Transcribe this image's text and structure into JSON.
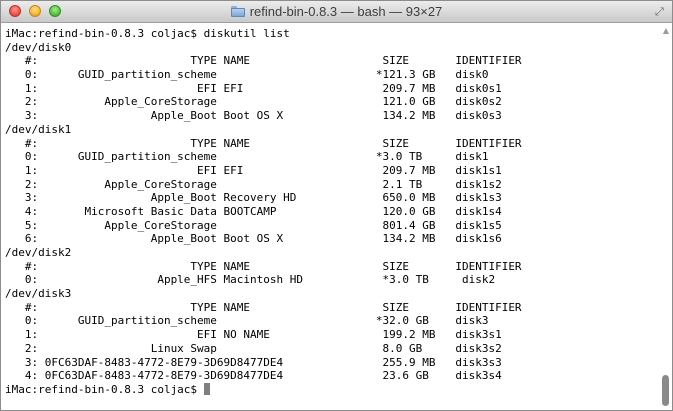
{
  "window": {
    "title": "refind-bin-0.8.3 — bash — 93×27",
    "icons": {
      "title_folder": "folder-icon",
      "fullscreen": "fullscreen-icon",
      "scroll_up": "chevron-up-icon"
    }
  },
  "terminal": {
    "lines": [
      "iMac:refind-bin-0.8.3 coljac$ diskutil list",
      "/dev/disk0",
      "   #:                       TYPE NAME                    SIZE       IDENTIFIER",
      "   0:      GUID_partition_scheme                        *121.3 GB   disk0",
      "   1:                        EFI EFI                     209.7 MB   disk0s1",
      "   2:          Apple_CoreStorage                         121.0 GB   disk0s2",
      "   3:                 Apple_Boot Boot OS X               134.2 MB   disk0s3",
      "/dev/disk1",
      "   #:                       TYPE NAME                    SIZE       IDENTIFIER",
      "   0:      GUID_partition_scheme                        *3.0 TB     disk1",
      "   1:                        EFI EFI                     209.7 MB   disk1s1",
      "   2:          Apple_CoreStorage                         2.1 TB     disk1s2",
      "   3:                 Apple_Boot Recovery HD             650.0 MB   disk1s3",
      "   4:       Microsoft Basic Data BOOTCAMP                120.0 GB   disk1s4",
      "   5:          Apple_CoreStorage                         801.4 GB   disk1s5",
      "   6:                 Apple_Boot Boot OS X               134.2 MB   disk1s6",
      "/dev/disk2",
      "   #:                       TYPE NAME                    SIZE       IDENTIFIER",
      "   0:                  Apple_HFS Macintosh HD            *3.0 TB     disk2",
      "/dev/disk3",
      "   #:                       TYPE NAME                    SIZE       IDENTIFIER",
      "   0:      GUID_partition_scheme                        *32.0 GB    disk3",
      "   1:                        EFI NO NAME                 199.2 MB   disk3s1",
      "   2:                 Linux Swap                         8.0 GB     disk3s2",
      "   3: 0FC63DAF-8483-4772-8E79-3D69D8477DE4               255.9 MB   disk3s3",
      "   4: 0FC63DAF-8483-4772-8E79-3D69D8477DE4               23.6 GB    disk3s4"
    ],
    "prompt": "iMac:refind-bin-0.8.3 coljac$ "
  }
}
